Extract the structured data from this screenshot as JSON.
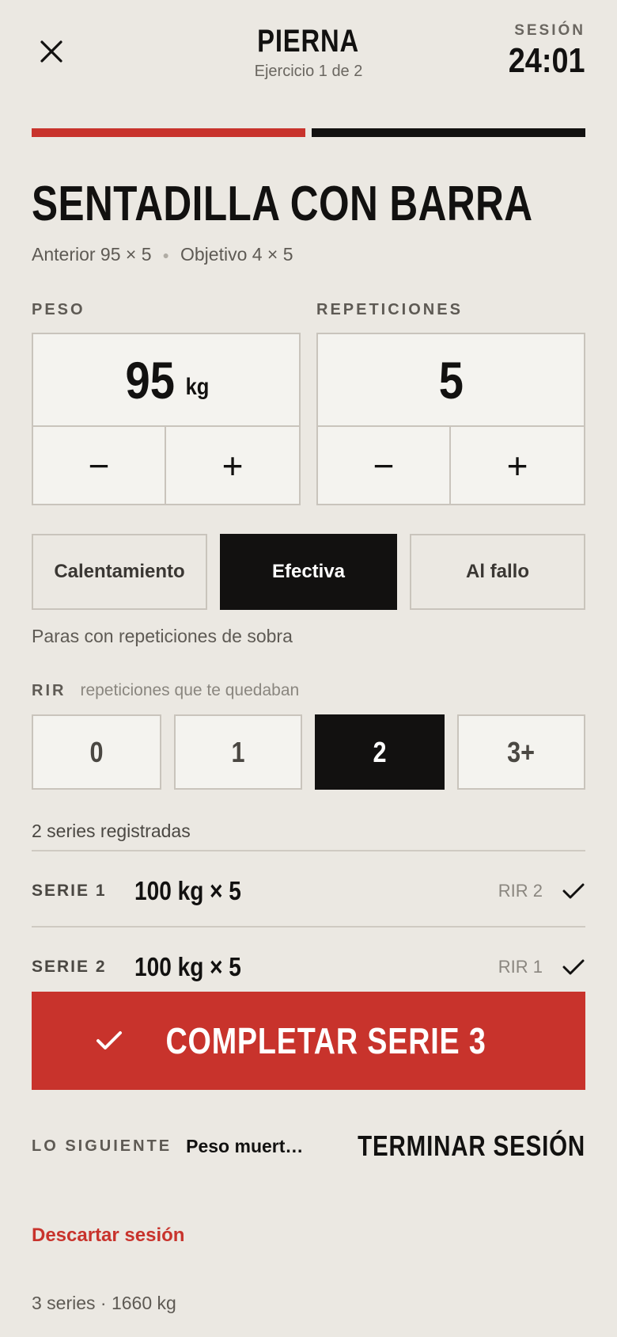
{
  "header": {
    "title": "PIERNA",
    "subtitle": "Ejercicio 1 de 2",
    "session_label": "SESIÓN",
    "session_time": "24:01"
  },
  "progress": {
    "completed_exercises": 1,
    "total_exercises": 2,
    "colors": {
      "done": "#c8332c",
      "pending": "#121110"
    }
  },
  "exercise": {
    "name": "SENTADILLA CON BARRA",
    "previous": "Anterior 95 × 5",
    "target": "Objetivo 4 × 5"
  },
  "weight": {
    "label": "PESO",
    "value": "95",
    "unit": "kg",
    "minus": "−",
    "plus": "+"
  },
  "reps": {
    "label": "REPETICIONES",
    "value": "5",
    "minus": "−",
    "plus": "+"
  },
  "set_types": {
    "options": [
      "Calentamiento",
      "Efectiva",
      "Al fallo"
    ],
    "selected": "Efectiva",
    "description": "Paras con repeticiones de sobra"
  },
  "rir": {
    "label": "RIR",
    "hint": "repeticiones que te quedaban",
    "options": [
      "0",
      "1",
      "2",
      "3+"
    ],
    "selected": "2"
  },
  "logged": {
    "count_text": "2 series registradas",
    "sets": [
      {
        "label": "SERIE 1",
        "value": "100 kg × 5",
        "rir": "RIR 2"
      },
      {
        "label": "SERIE 2",
        "value": "100 kg × 5",
        "rir": "RIR 1"
      }
    ]
  },
  "complete_button": {
    "label": "COMPLETAR SERIE 3",
    "color": "#c8332c"
  },
  "next": {
    "label": "LO SIGUIENTE",
    "value": "Peso muerto rum...",
    "finish_label": "TERMINAR SESIÓN"
  },
  "discard_label": "Descartar sesión",
  "summary": "3 series · 1660 kg"
}
